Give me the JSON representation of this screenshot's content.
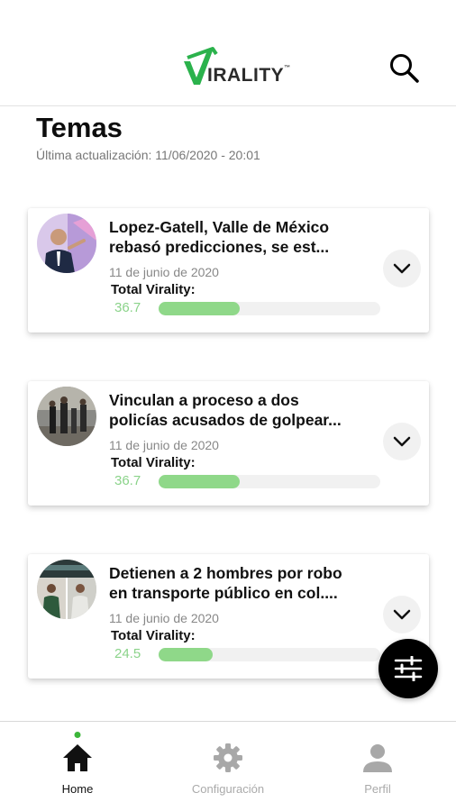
{
  "header": {
    "logo_text": "IRALITY",
    "logo_tm": "™",
    "search_icon": "search-icon"
  },
  "page": {
    "title": "Temas",
    "updated": "Última actualización: 11/06/2020 - 20:01"
  },
  "virality_label": "Total Virality:",
  "cards": [
    {
      "title_line1": "Lopez-Gatell, Valle de México",
      "title_line2": "rebasó predicciones, se est...",
      "date": "11 de junio de 2020",
      "virality": "36.7",
      "virality_fraction": 0.367
    },
    {
      "title_line1": "Vinculan a proceso a dos",
      "title_line2": "policías acusados de golpear...",
      "date": "11 de junio de 2020",
      "virality": "36.7",
      "virality_fraction": 0.367
    },
    {
      "title_line1": "Detienen a 2 hombres por robo",
      "title_line2": "en transporte público en col....",
      "date": "11 de junio de 2020",
      "virality": "24.5",
      "virality_fraction": 0.245
    }
  ],
  "tabs": [
    {
      "label": "Home",
      "icon": "home-icon",
      "active": true
    },
    {
      "label": "Configuración",
      "icon": "gear-icon",
      "active": false
    },
    {
      "label": "Perfil",
      "icon": "user-icon",
      "active": false
    }
  ],
  "colors": {
    "accent_green": "#8fd889",
    "logo_green": "#2bb24c",
    "active_dot": "#3cb63a"
  }
}
